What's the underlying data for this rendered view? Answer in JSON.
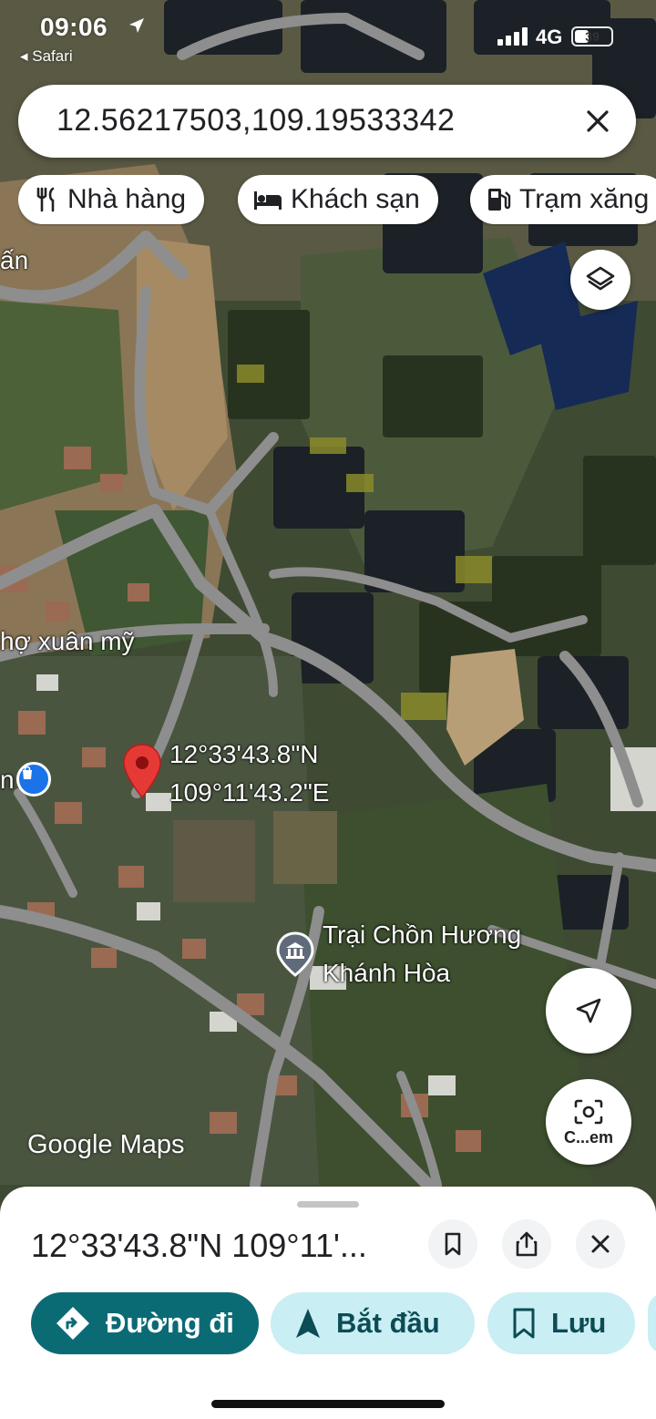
{
  "status_bar": {
    "time": "09:06",
    "back_app": "◂ Safari",
    "network": "4G",
    "battery": "39",
    "battery_level": 0.39
  },
  "search": {
    "query": "12.56217503,109.19533342",
    "close_icon": "close-icon"
  },
  "chips": [
    {
      "label": "Nhà hàng",
      "icon": "restaurant-icon"
    },
    {
      "label": "Khách sạn",
      "icon": "hotel-icon"
    },
    {
      "label": "Trạm xăng",
      "icon": "gas-station-icon"
    }
  ],
  "map": {
    "labels": {
      "left_fragment": "ấn",
      "market": "hợ xuân mỹ",
      "pin_lat": "12°33'43.8\"N",
      "pin_lng": "109°11'43.2\"E",
      "poi_line1": "Trại Chồn Hương",
      "poi_line2": "Khánh Hòa",
      "left_edge": "n"
    },
    "watermark": "Google Maps",
    "layers_icon": "layers-icon",
    "navigate_icon": "navigation-arrow-icon",
    "camera_label": "C...em",
    "colors": {
      "pin": "#e53935",
      "road": "#8e8e8e",
      "poi_blue": "#1a73e8",
      "poi_gray": "#5f6b7a"
    }
  },
  "bottom_sheet": {
    "title": "12°33'43.8\"N 109°11'...",
    "actions": {
      "directions": "Đường đi",
      "start": "Bắt đầu",
      "save": "Lưu"
    },
    "colors": {
      "primary": "#0b6b75",
      "tonal": "#c9eef3"
    }
  }
}
